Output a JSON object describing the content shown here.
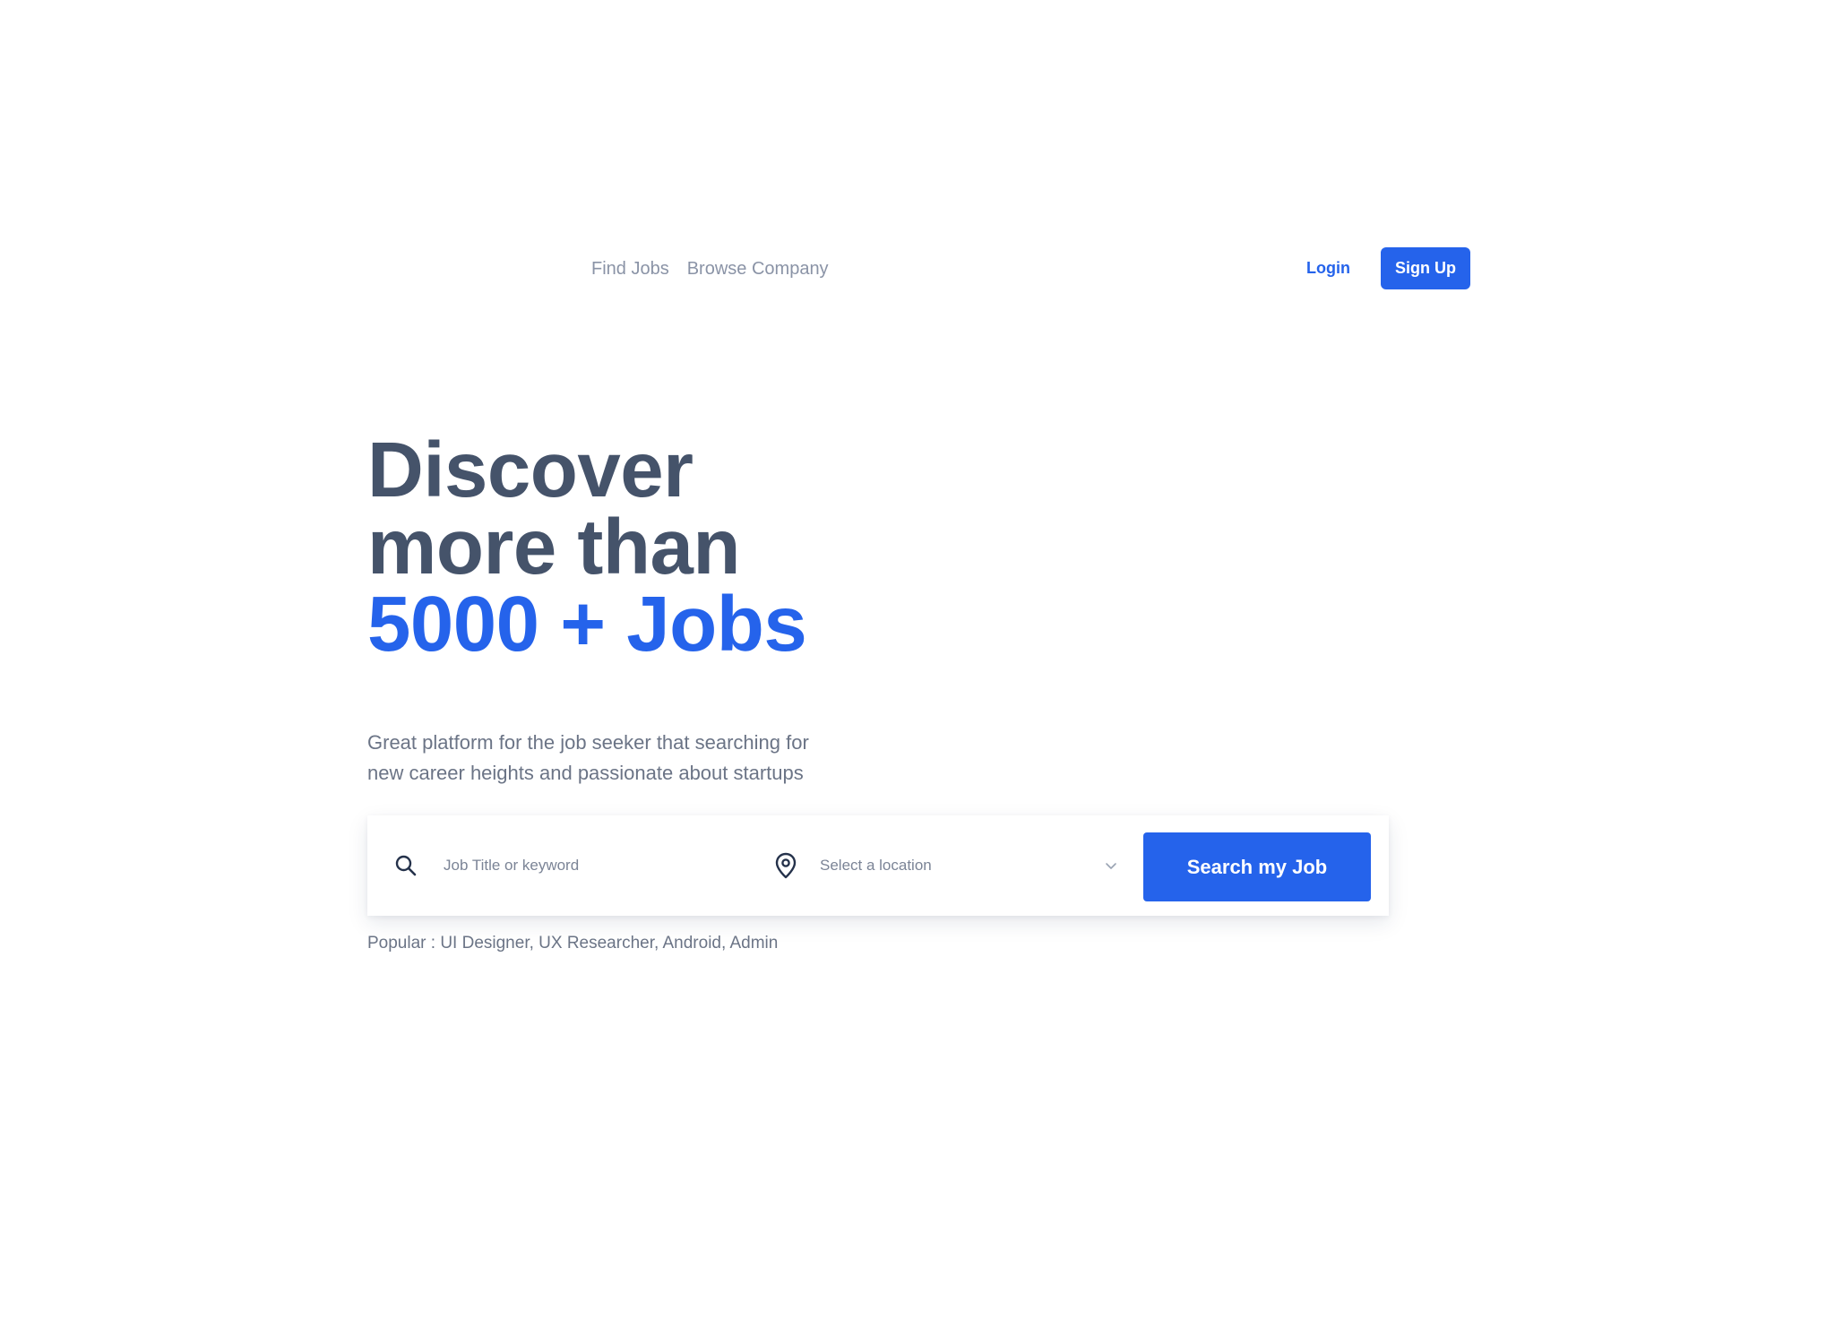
{
  "nav": {
    "links": [
      "Find Jobs",
      "Browse Company"
    ],
    "login_label": "Login",
    "signup_label": "Sign Up"
  },
  "hero": {
    "title_line1": "Discover",
    "title_line2": "more than",
    "title_accent": "5000 + Jobs",
    "description_line1": "Great platform for the job seeker that searching for",
    "description_line2": "new career heights and passionate about startups"
  },
  "search": {
    "keyword_placeholder": "Job Title or keyword",
    "location_placeholder": "Select a location",
    "button_label": "Search my Job"
  },
  "popular": {
    "text": "Popular : UI Designer, UX Researcher, Android, Admin"
  },
  "icons": {
    "search": "search-icon",
    "location": "map-pin-icon",
    "dropdown": "chevron-down-icon"
  },
  "colors": {
    "accent": "#2563eb",
    "heading": "#45536a",
    "body_text": "#6b7486",
    "nav_text": "#8a93a6"
  }
}
